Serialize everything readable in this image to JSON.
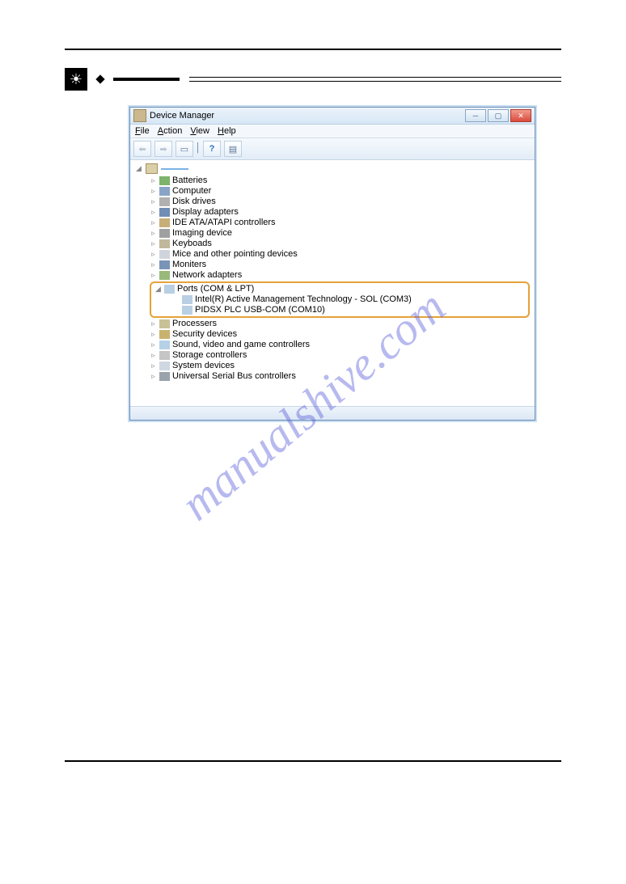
{
  "window": {
    "title": "Device Manager",
    "menu": {
      "file": "File",
      "action": "Action",
      "view": "View",
      "help": "Help"
    },
    "controls": {
      "min": "─",
      "max": "▢",
      "close": "✕"
    }
  },
  "toolbar": {
    "back": "⬅",
    "forward": "➡",
    "up": "▭",
    "divider": "│",
    "help": "?",
    "prop": "▤"
  },
  "tree": {
    "root_label": "",
    "items": [
      {
        "label": "Batteries",
        "icon": "i-batt"
      },
      {
        "label": "Computer",
        "icon": "i-comp"
      },
      {
        "label": "Disk drives",
        "icon": "i-disk"
      },
      {
        "label": "Display adapters",
        "icon": "i-disp"
      },
      {
        "label": "IDE ATA/ATAPI controllers",
        "icon": "i-ide"
      },
      {
        "label": "Imaging device",
        "icon": "i-img"
      },
      {
        "label": "Keyboads",
        "icon": "i-kbd"
      },
      {
        "label": "Mice and other pointing devices",
        "icon": "i-mouse"
      },
      {
        "label": "Moniters",
        "icon": "i-mon"
      },
      {
        "label": "Network adapters",
        "icon": "i-net"
      }
    ],
    "ports": {
      "label": "Ports (COM & LPT)",
      "children": [
        "Intel(R) Active Management Technology - SOL (COM3)",
        "PIDSX PLC USB-COM (COM10)"
      ]
    },
    "items2": [
      {
        "label": "Processers",
        "icon": "i-proc"
      },
      {
        "label": "Security devices",
        "icon": "i-sec"
      },
      {
        "label": "Sound, video and game controllers",
        "icon": "i-snd"
      },
      {
        "label": "Storage controllers",
        "icon": "i-stor"
      },
      {
        "label": "System devices",
        "icon": "i-sys"
      },
      {
        "label": "Universal Serial Bus controllers",
        "icon": "i-usb"
      }
    ]
  },
  "watermark": "manualshive.com"
}
